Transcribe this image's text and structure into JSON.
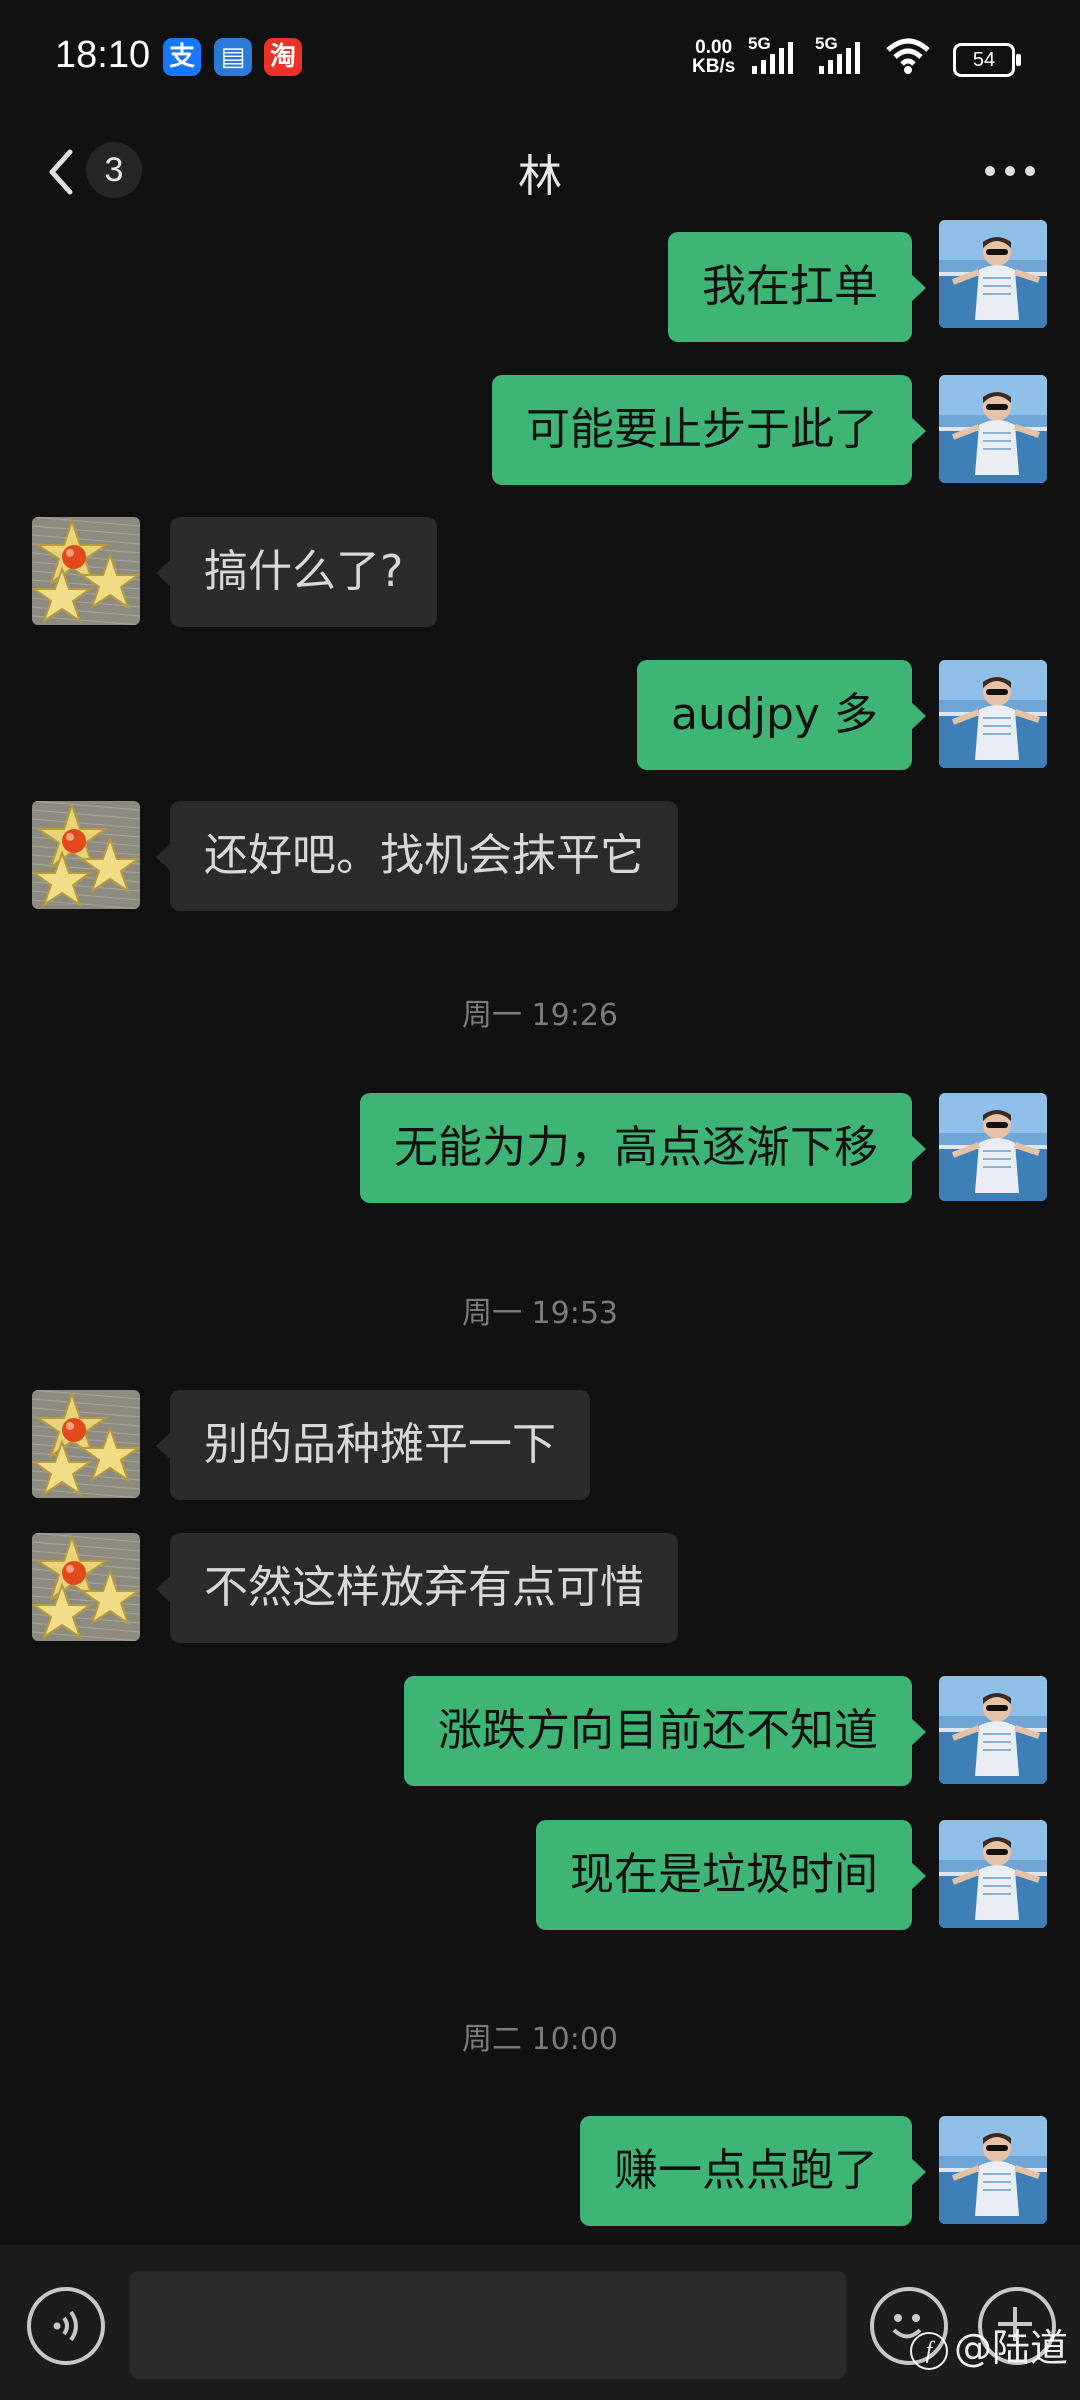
{
  "status_bar": {
    "time": "18:10",
    "apps": [
      {
        "icon": "alipay-icon",
        "glyph": "支",
        "color": "#1677ff"
      },
      {
        "icon": "wallet-icon",
        "glyph": "▤",
        "color": "#2b7bd6"
      },
      {
        "icon": "taobao-icon",
        "glyph": "淘",
        "color": "#e8322a"
      }
    ],
    "net_speed_value": "0.00",
    "net_speed_unit": "KB/s",
    "signal1_label": "5G",
    "signal2_label": "5G",
    "battery": "54"
  },
  "nav": {
    "unread_count": "3",
    "title": "林"
  },
  "messages": [
    {
      "side": "me",
      "text": "我在扛单"
    },
    {
      "side": "me",
      "text": "可能要止步于此了"
    },
    {
      "side": "other",
      "text": "搞什么了?"
    },
    {
      "side": "me",
      "text": "audjpy 多"
    },
    {
      "side": "other",
      "text": "还好吧。找机会抹平它"
    },
    {
      "type": "time",
      "text": "周一 19:26"
    },
    {
      "side": "me",
      "text": "无能为力，高点逐渐下移"
    },
    {
      "type": "time",
      "text": "周一 19:53"
    },
    {
      "side": "other",
      "text": "别的品种摊平一下"
    },
    {
      "side": "other",
      "text": "不然这样放弃有点可惜"
    },
    {
      "side": "me",
      "text": "涨跌方向目前还不知道"
    },
    {
      "side": "me",
      "text": "现在是垃圾时间"
    },
    {
      "type": "time",
      "text": "周二 10:00"
    },
    {
      "side": "me",
      "text": "赚一点点跑了"
    }
  ],
  "input": {
    "placeholder": ""
  },
  "watermark": "@陆道",
  "colors": {
    "background": "#111111",
    "my_bubble": "#3eb575",
    "other_bubble": "#2b2b2b"
  }
}
